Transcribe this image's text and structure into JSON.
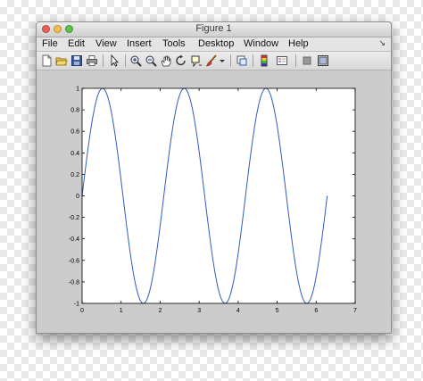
{
  "window": {
    "title": "Figure 1"
  },
  "menu": {
    "items": [
      {
        "label": "File"
      },
      {
        "label": "Edit"
      },
      {
        "label": "View"
      },
      {
        "label": "Insert"
      },
      {
        "label": "Tools"
      },
      {
        "label": "Desktop"
      },
      {
        "label": "Window"
      },
      {
        "label": "Help"
      }
    ],
    "overflow_glyph": "↘"
  },
  "toolbar": {
    "icons": [
      "new-figure-icon",
      "open-file-icon",
      "save-icon",
      "print-icon",
      "select-arrow-icon",
      "zoom-in-icon",
      "zoom-out-icon",
      "pan-hand-icon",
      "rotate-3d-icon",
      "data-cursor-icon",
      "brush-icon",
      "brush-dropdown-icon",
      "link-plot-icon",
      "insert-colorbar-icon",
      "insert-legend-icon",
      "hide-plot-tools-icon",
      "show-plot-tools-icon"
    ]
  },
  "colors": {
    "line": "#2f5bbd",
    "axes_bg": "#ffffff",
    "figure_bg": "#cccccc"
  },
  "chart_data": {
    "type": "line",
    "function": "sin(3x)",
    "x_range": [
      0,
      6.283
    ],
    "xlim": [
      0,
      7
    ],
    "ylim": [
      -1,
      1
    ],
    "xticks": [
      "0",
      "1",
      "2",
      "3",
      "4",
      "5",
      "6",
      "7"
    ],
    "yticks": [
      "-1",
      "-0.8",
      "-0.6",
      "-0.4",
      "-0.2",
      "0",
      "0.2",
      "0.4",
      "0.6",
      "0.8",
      "1"
    ],
    "series": [
      {
        "color": "#2f5bbd"
      }
    ],
    "grid": false,
    "title": "",
    "xlabel": "",
    "ylabel": ""
  }
}
